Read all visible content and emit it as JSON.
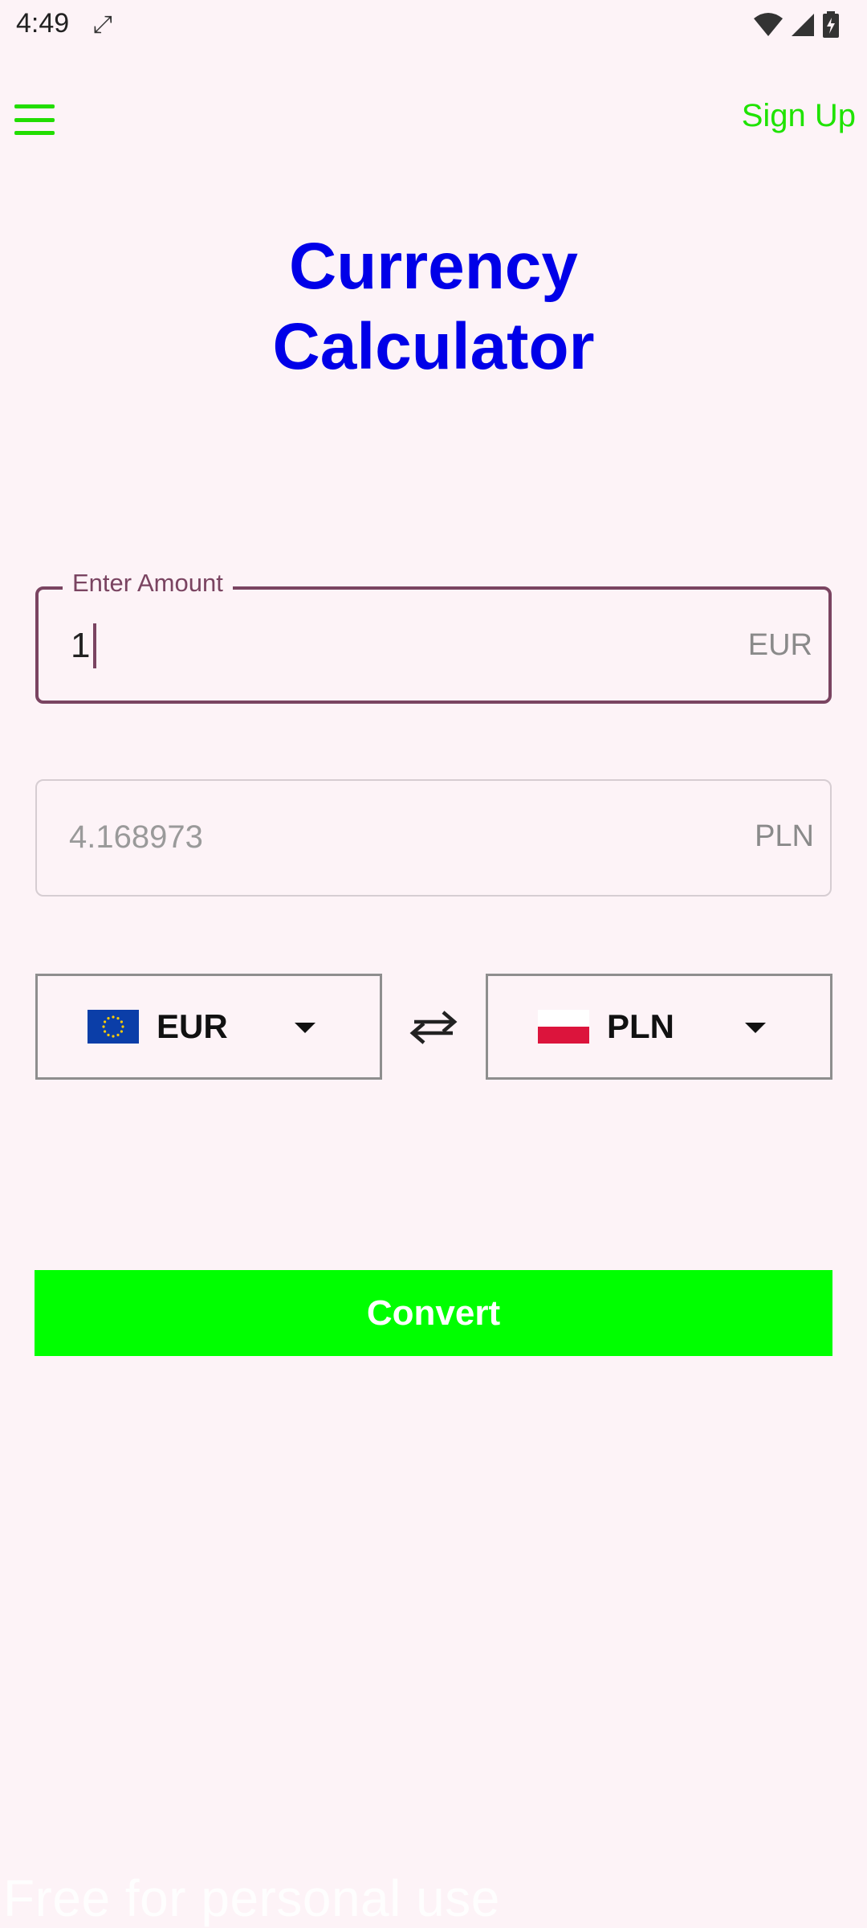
{
  "status_bar": {
    "time": "4:49"
  },
  "header": {
    "signup_label": "Sign Up"
  },
  "title": {
    "line1": "Currency",
    "line2": "Calculator"
  },
  "amount_field": {
    "label": "Enter Amount",
    "value": "1",
    "suffix": "EUR"
  },
  "result_field": {
    "value": "4.168973",
    "suffix": "PLN"
  },
  "from_currency": {
    "code": "EUR",
    "flag_icon": "eu-flag-icon"
  },
  "to_currency": {
    "code": "PLN",
    "flag_icon": "poland-flag-icon"
  },
  "convert_label": "Convert",
  "watermark": "Free for personal use",
  "colors": {
    "accent": "#00ff00",
    "title": "#0000e8",
    "field_border": "#7a4461"
  }
}
